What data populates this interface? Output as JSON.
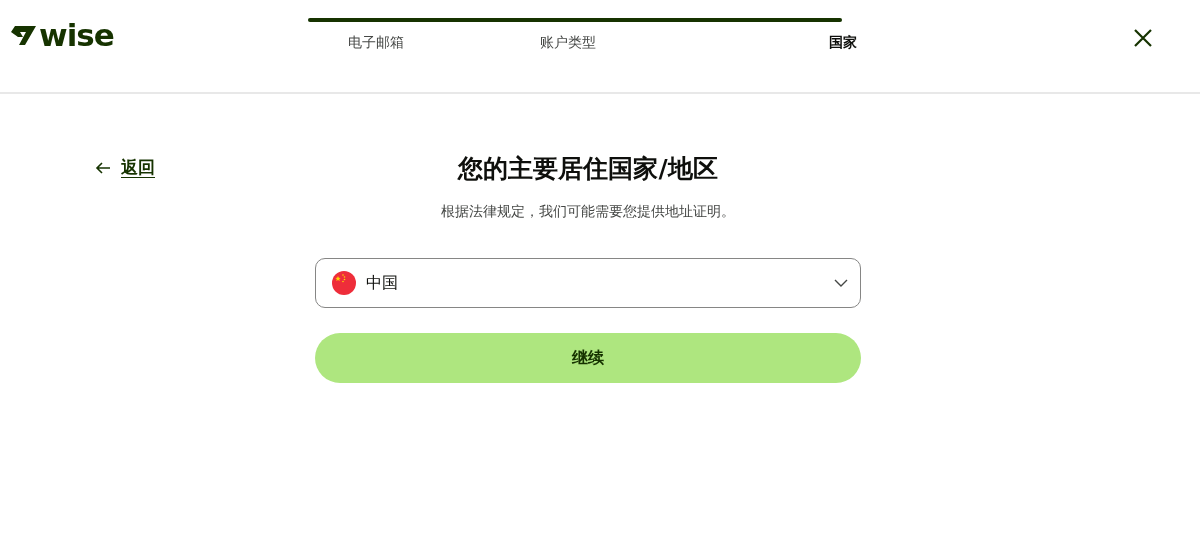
{
  "logo": {
    "text": "wise"
  },
  "progress": {
    "level": 1,
    "steps": [
      {
        "label": "电子邮箱",
        "selected": false
      },
      {
        "label": "账户类型",
        "selected": false
      },
      {
        "label": "国家",
        "selected": true
      }
    ]
  },
  "back_link": {
    "label": "返回"
  },
  "title": "您的主要居住国家/地区",
  "subtitle": "根据法律规定，我们可能需要您提供地址证明。",
  "country_select": {
    "value": "中国"
  },
  "continue_button": {
    "label": "继续"
  }
}
